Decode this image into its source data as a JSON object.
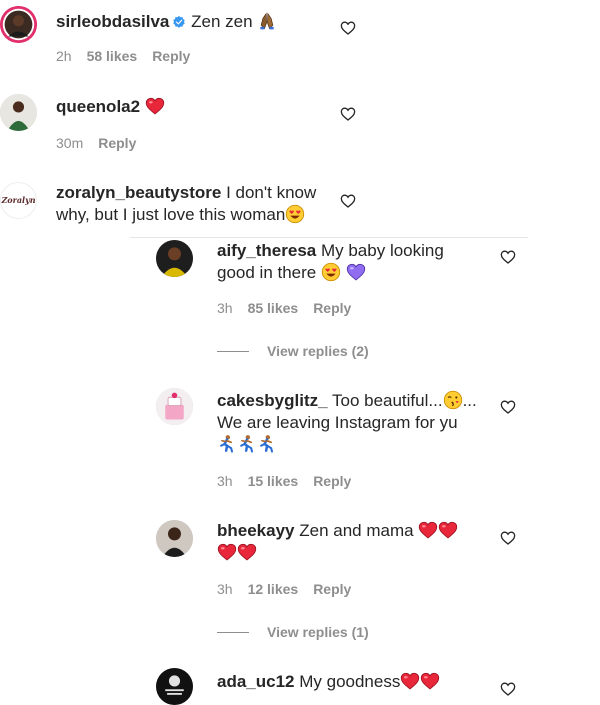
{
  "comments": [
    {
      "username": "sirleobdasilva",
      "text": "Zen zen",
      "time": "2h",
      "likes": "58 likes",
      "reply": "Reply"
    },
    {
      "username": "queenola2",
      "text": "",
      "time": "30m",
      "reply": "Reply"
    },
    {
      "username": "zoralyn_beautystore",
      "text_line1": "I don't know",
      "text_line2": "why, but I just love this woman",
      "avatar_text": "Zoralyn"
    },
    {
      "username": "aify_theresa",
      "text_line1": "My baby looking",
      "text_line2": "good in there",
      "time": "3h",
      "likes": "85 likes",
      "reply": "Reply",
      "view_replies": "View replies (2)"
    },
    {
      "username": "cakesbyglitz_",
      "text_line1": "Too beautiful...",
      "text_line1_end": "...",
      "text_line2": "We are leaving Instagram for yu",
      "time": "3h",
      "likes": "15 likes",
      "reply": "Reply"
    },
    {
      "username": "bheekayy",
      "text": "Zen and mama",
      "time": "3h",
      "likes": "12 likes",
      "reply": "Reply",
      "view_replies": "View replies (1)"
    },
    {
      "username": "ada_uc12",
      "text": "My goodness"
    }
  ],
  "colors": {
    "heart_red": "#ed4956",
    "meta_gray": "#8e8e8e",
    "text": "#262626",
    "verified": "#3897f0",
    "purple_heart": "#8f6cf0"
  },
  "icons": [
    "like-heart-outline-icon",
    "red-heart-emoji",
    "heart-eyes-emoji",
    "purple-heart-emoji",
    "kiss-emoji",
    "runner-emoji",
    "pray-hands-emoji",
    "verified-badge-icon"
  ]
}
